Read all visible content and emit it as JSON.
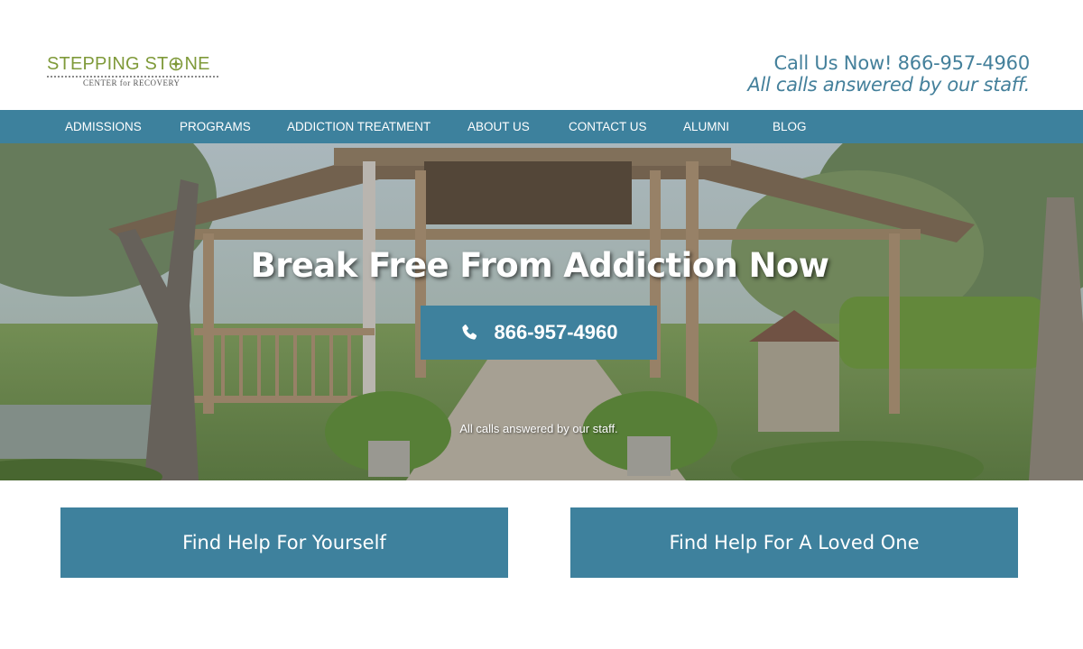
{
  "logo": {
    "title_a": "STEPPING ST",
    "title_b": "NE",
    "subtitle": "CENTER for RECOVERY",
    "colors": {
      "green": "#7f9a3a"
    }
  },
  "header": {
    "call_line": "Call Us Now! 866-957-4960",
    "call_note": "All calls answered by our staff."
  },
  "nav": {
    "items": [
      "ADMISSIONS",
      "PROGRAMS",
      "ADDICTION TREATMENT",
      "ABOUT US",
      "CONTACT US",
      "ALUMNI",
      "BLOG"
    ]
  },
  "hero": {
    "title": "Break Free From Addiction Now",
    "phone_icon": "phone-icon",
    "phone": "866-957-4960",
    "note": "All calls answered by our staff."
  },
  "cta": {
    "yourself": "Find Help For Yourself",
    "loved_one": "Find Help For A Loved One"
  },
  "colors": {
    "brand_blue": "#3e819d",
    "text_blue": "#44809b",
    "white": "#ffffff"
  }
}
